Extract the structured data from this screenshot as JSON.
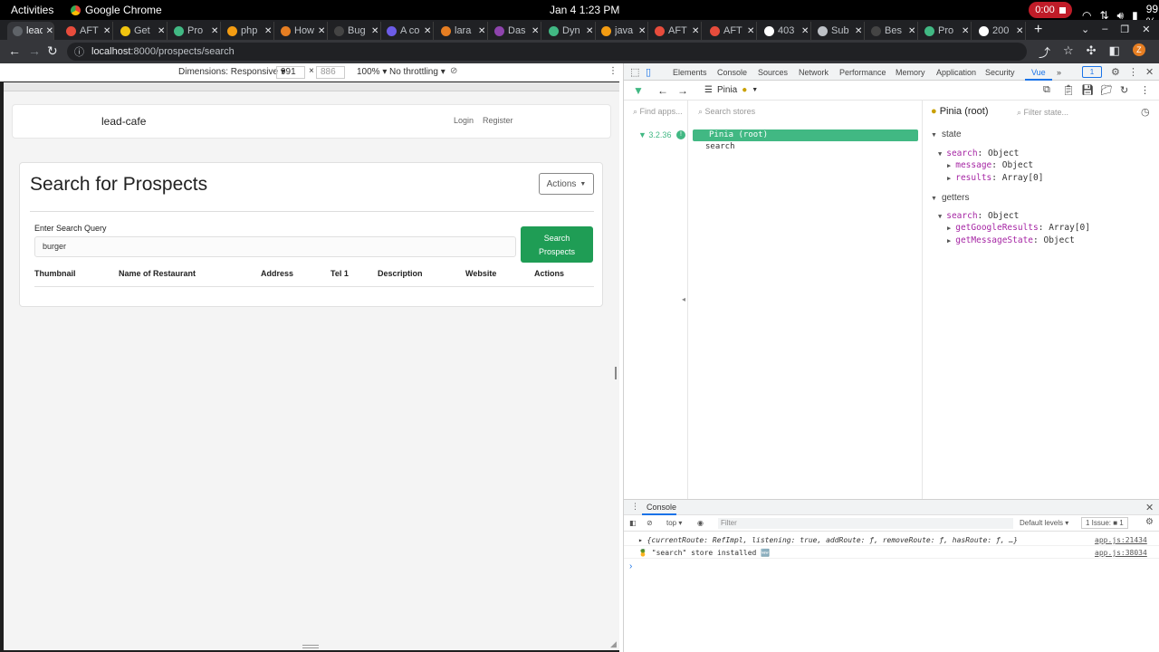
{
  "topbar": {
    "activities": "Activities",
    "app_name": "Google Chrome",
    "clock": "Jan 4  1:23 PM",
    "recording_time": "0:00",
    "battery": "99 %"
  },
  "tabs": [
    {
      "title": "lead",
      "color": "#5f6368",
      "active": true
    },
    {
      "title": "AFT",
      "color": "#e74c3c"
    },
    {
      "title": "Get",
      "color": "#f1c40f"
    },
    {
      "title": "Pro",
      "color": "#41b883"
    },
    {
      "title": "php",
      "color": "#f39c12"
    },
    {
      "title": "How",
      "color": "#e67e22"
    },
    {
      "title": "Bug",
      "color": "#444444"
    },
    {
      "title": "A co",
      "color": "#6c5ce7"
    },
    {
      "title": "lara",
      "color": "#e67e22"
    },
    {
      "title": "Das",
      "color": "#8e44ad"
    },
    {
      "title": "Dyn",
      "color": "#41b883"
    },
    {
      "title": "java",
      "color": "#f39c12"
    },
    {
      "title": "AFT",
      "color": "#e74c3c"
    },
    {
      "title": "AFT",
      "color": "#e74c3c"
    },
    {
      "title": "403",
      "color": "#ffffff"
    },
    {
      "title": "Sub",
      "color": "#bdc1c6"
    },
    {
      "title": "Bes",
      "color": "#444444"
    },
    {
      "title": "Pro",
      "color": "#41b883"
    },
    {
      "title": "200",
      "color": "#ffffff"
    }
  ],
  "address": {
    "host": "localhost",
    "path": ":8000/prospects/search",
    "profile_initial": "Z"
  },
  "device_toolbar": {
    "dimensions": "Dimensions: Responsive ▾",
    "width": "991",
    "height": "886",
    "zoom": "100% ▾",
    "throttling": "No throttling ▾"
  },
  "app": {
    "brand": "lead-cafe",
    "login": "Login",
    "register": "Register",
    "page_title": "Search for Prospects",
    "actions_button": "Actions",
    "query_label": "Enter Search Query",
    "query_value": "burger",
    "search_button_line1": "Search",
    "search_button_line2": "Prospects",
    "columns": [
      "Thumbnail",
      "Name of Restaurant",
      "Address",
      "Tel 1",
      "Description",
      "Website",
      "Actions"
    ]
  },
  "devtools": {
    "tabs": [
      "Elements",
      "Console",
      "Sources",
      "Network",
      "Performance",
      "Memory",
      "Application",
      "Security",
      "Vue"
    ],
    "issues_count": "1",
    "vue": {
      "plugin": "Pinia",
      "find_apps_placeholder": "Find apps...",
      "search_stores_placeholder": "Search stores",
      "version": "3.2.36",
      "root_label": "Pinia (root)",
      "store_name": "search",
      "inspector_title": "Pinia (root)",
      "filter_placeholder": "Filter state...",
      "state_label": "state",
      "getters_label": "getters",
      "state_rows": [
        {
          "key": "search",
          "value": "Object"
        },
        {
          "key": "message",
          "value": "Object"
        },
        {
          "key": "results",
          "value": "Array[0]"
        }
      ],
      "getter_rows": [
        {
          "key": "search",
          "value": "Object"
        },
        {
          "key": "getGoogleResults",
          "value": "Array[0]"
        },
        {
          "key": "getMessageState",
          "value": "Object"
        }
      ]
    },
    "console": {
      "tab_label": "Console",
      "context": "top ▾",
      "filter_placeholder": "Filter",
      "levels": "Default levels ▾",
      "issues": "1 Issue: ■ 1",
      "lines": [
        {
          "msg": "▸ {currentRoute: RefImpl, listening: true, addRoute: ƒ, removeRoute: ƒ, hasRoute: ƒ, …}",
          "src": "app.js:21434"
        },
        {
          "msg": "🍍 \"search\" store installed 🆕",
          "src": "app.js:38034"
        }
      ]
    }
  }
}
